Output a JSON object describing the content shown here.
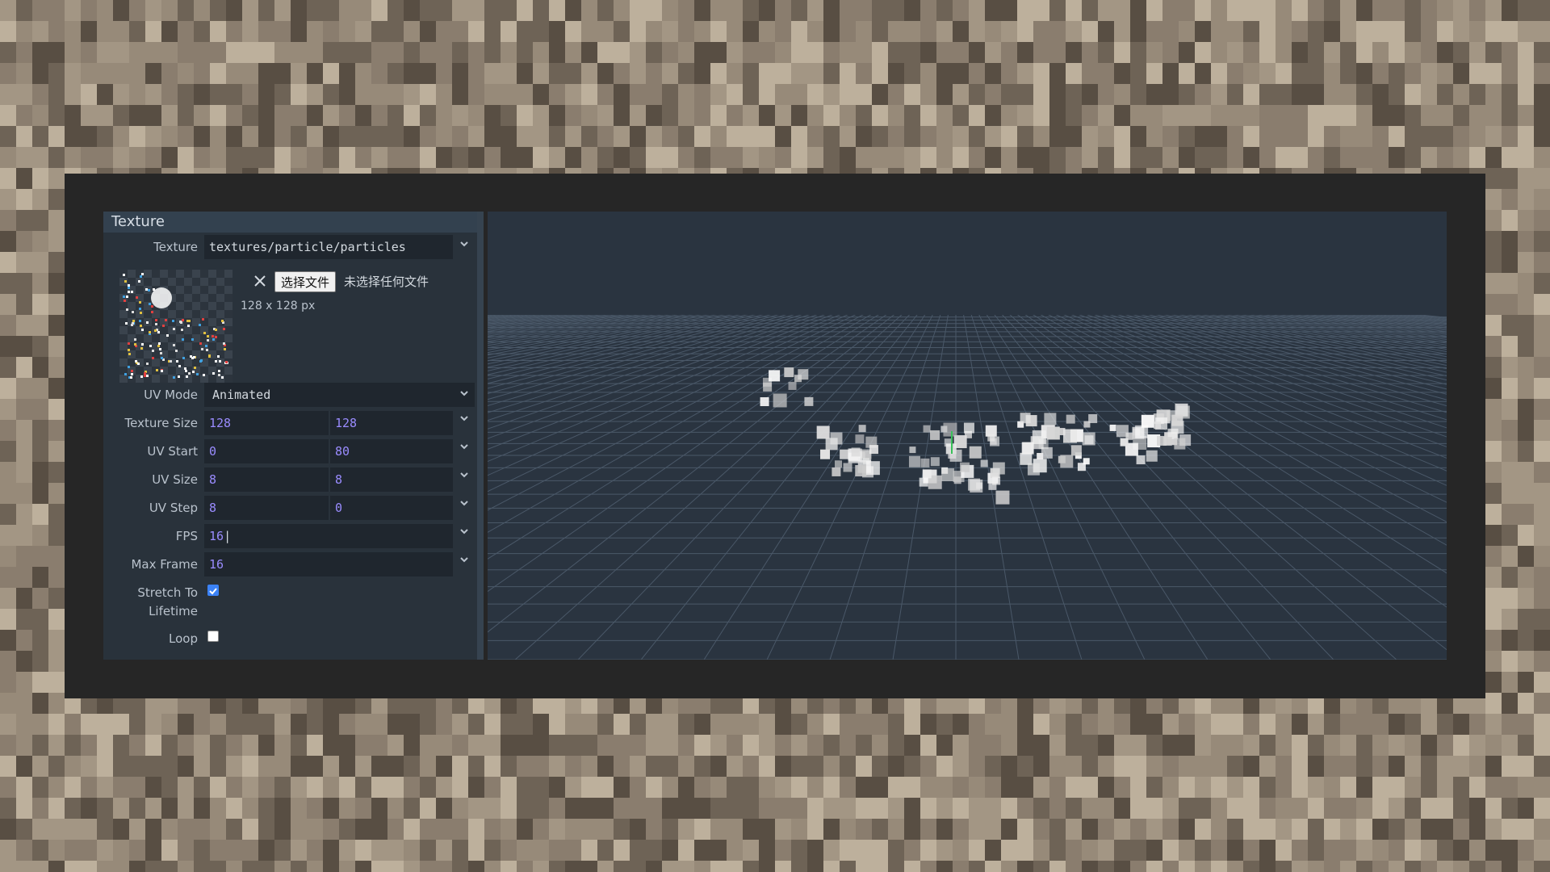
{
  "panel": {
    "title": "Texture",
    "texture": {
      "label": "Texture",
      "value": "textures/particle/particles"
    },
    "file": {
      "choose_label": "选择文件",
      "no_file_text": "未选择任何文件",
      "dimensions": "128 x 128 px"
    },
    "uv_mode": {
      "label": "UV Mode",
      "value": "Animated"
    },
    "texture_size": {
      "label": "Texture Size",
      "x": "128",
      "y": "128"
    },
    "uv_start": {
      "label": "UV Start",
      "x": "0",
      "y": "80"
    },
    "uv_size": {
      "label": "UV Size",
      "x": "8",
      "y": "8"
    },
    "uv_step": {
      "label": "UV Step",
      "x": "8",
      "y": "0"
    },
    "fps": {
      "label": "FPS",
      "value": "16"
    },
    "max_frame": {
      "label": "Max Frame",
      "value": "16"
    },
    "stretch_to_lifetime": {
      "label_line1": "Stretch To",
      "label_line2": "Lifetime",
      "checked": true
    },
    "loop": {
      "label": "Loop",
      "checked": false
    }
  },
  "icons": {
    "dropdown": "chevron-down-icon",
    "clear": "close-icon",
    "spinner": "spinner-arrows-icon"
  },
  "colors": {
    "panel_bg": "#29323b",
    "header_bg": "#33414f",
    "field_bg": "#1f262e",
    "number_text": "#9a8cff",
    "viewport_bg": "#2a3440",
    "grid": "#4a5868",
    "checkbox_accent": "#3b82f6"
  }
}
